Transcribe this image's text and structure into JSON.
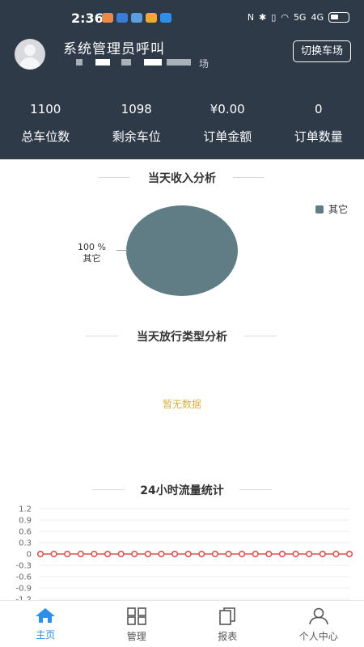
{
  "status_bar": {
    "time": "2:36",
    "signal_5g": "5G",
    "signal_4g": "4G"
  },
  "profile": {
    "user_name": "系统管理员呼叫",
    "lot_name_suffix": "场",
    "switch_lot_label": "切换车场"
  },
  "stats": [
    {
      "value": "1100",
      "label": "总车位数"
    },
    {
      "value": "1098",
      "label": "剩余车位"
    },
    {
      "value": "¥0.00",
      "label": "订单金额"
    },
    {
      "value": "0",
      "label": "订单数量"
    }
  ],
  "income_section": {
    "title": "当天收入分析"
  },
  "release_section": {
    "title": "当天放行类型分析",
    "empty_text": "暂无数据"
  },
  "traffic_section": {
    "title": "24小时流量统计"
  },
  "tabs": [
    {
      "label": "主页",
      "icon": "home-icon"
    },
    {
      "label": "管理",
      "icon": "grid-icon"
    },
    {
      "label": "报表",
      "icon": "report-icon"
    },
    {
      "label": "个人中心",
      "icon": "user-icon"
    }
  ],
  "colors": {
    "header_bg": "#2e3a48",
    "pie_slice": "#607d86",
    "line_series": "#d9534f",
    "active_tab": "#2b8ee8",
    "empty_text": "#d9b245"
  },
  "chart_data": [
    {
      "type": "pie",
      "title": "当天收入分析",
      "slices": [
        {
          "label": "其它",
          "value": 100,
          "percent_label": "100 %"
        }
      ],
      "legend": [
        "其它"
      ],
      "legend_position": "top-right"
    },
    {
      "type": "line",
      "title": "24小时流量统计",
      "y_ticks": [
        "1.2",
        "0.9",
        "0.6",
        "0.3",
        "0",
        "-0.3",
        "-0.6",
        "-0.9",
        "-1.2"
      ],
      "ylim": [
        -1.2,
        1.2
      ],
      "grid": true,
      "series": [
        {
          "values": [
            0,
            0,
            0,
            0,
            0,
            0,
            0,
            0,
            0,
            0,
            0,
            0,
            0,
            0,
            0,
            0,
            0,
            0,
            0,
            0,
            0,
            0,
            0,
            0
          ]
        }
      ]
    }
  ]
}
